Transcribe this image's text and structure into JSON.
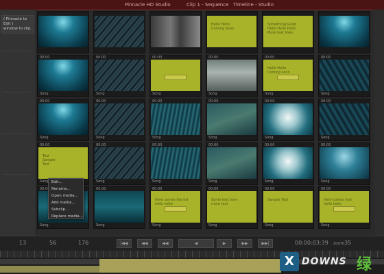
{
  "window": {
    "title_left": "Pinnacle HD Studio",
    "title_center": "Clip 1 - Sequence",
    "title_right": "Timeline - Studio"
  },
  "sidebar": {
    "note": "( Pinnacle to Edit )\nwindow to clip"
  },
  "tiles": [
    {
      "kind": "deep-sea",
      "tc": "",
      "label": ""
    },
    {
      "kind": "fish-school",
      "tc": "",
      "label": ""
    },
    {
      "kind": "branch",
      "tc": "",
      "label": ""
    },
    {
      "kind": "yellow",
      "tc": "",
      "label": "",
      "text": "Hello Hello\nComing Soon"
    },
    {
      "kind": "yellow",
      "tc": "",
      "label": "",
      "text": "Something Good\nHello Hello Hello\nMore text lines"
    },
    {
      "kind": "deep-sea",
      "tc": "",
      "label": ""
    },
    {
      "kind": "deep-sea",
      "tc": "00:00",
      "label": "Song"
    },
    {
      "kind": "fish-school",
      "tc": "00:00",
      "label": "Song"
    },
    {
      "kind": "yellow-btn",
      "tc": "00:00",
      "label": "Song"
    },
    {
      "kind": "rocks",
      "tc": "00:00",
      "label": "Song"
    },
    {
      "kind": "yellow-btn",
      "tc": "00:00",
      "label": "Song",
      "text": "Hello Hello\nComing soon"
    },
    {
      "kind": "fish-dark",
      "tc": "00:00",
      "label": "Song"
    },
    {
      "kind": "deep-sea",
      "tc": "00:00",
      "label": "Song"
    },
    {
      "kind": "fish-school",
      "tc": "00:00",
      "label": "Song"
    },
    {
      "kind": "kelp",
      "tc": "00:00",
      "label": "Song"
    },
    {
      "kind": "fish-teal",
      "tc": "00:00",
      "label": "Song"
    },
    {
      "kind": "cloud",
      "tc": "00:00",
      "label": "Song"
    },
    {
      "kind": "fish-dark",
      "tc": "00:00",
      "label": "Song"
    },
    {
      "kind": "yellow",
      "tc": "00:00",
      "label": "Song",
      "text": "Text\nSample\nText"
    },
    {
      "kind": "fish-school",
      "tc": "00:00",
      "label": "Song"
    },
    {
      "kind": "kelp",
      "tc": "00:00",
      "label": "Song"
    },
    {
      "kind": "fish-teal",
      "tc": "00:00",
      "label": "Song"
    },
    {
      "kind": "cloud",
      "tc": "00:00",
      "label": "Song"
    },
    {
      "kind": "fish-blue",
      "tc": "00:00",
      "label": "Song"
    },
    {
      "kind": "teal-dark",
      "tc": "00:00",
      "label": "Song"
    },
    {
      "kind": "teal-dark",
      "tc": "00:00",
      "label": "Song"
    },
    {
      "kind": "yellow-btn",
      "tc": "00:00",
      "label": "Song",
      "text": "Here comes the list\nhello hello"
    },
    {
      "kind": "yellow",
      "tc": "00:00",
      "label": "Song",
      "text": "Some text here\nmore text"
    },
    {
      "kind": "yellow",
      "tc": "00:00",
      "label": "Song",
      "text": "Sample Text"
    },
    {
      "kind": "yellow-btn",
      "tc": "00:00",
      "label": "Song",
      "text": "Here comes text\nhello hello"
    }
  ],
  "context_menu": [
    "Edit...",
    "Rename...",
    "Open media...",
    "Add media...",
    "Subclip...",
    "Replace media..."
  ],
  "transport": {
    "left_num_a": "13",
    "left_num_b": "56",
    "left_num_c": "176",
    "timecode": "00:00:03:39",
    "zoom_label": "zoom",
    "zoom_value": "35",
    "buttons": [
      "|◀◀",
      "◀◀",
      "◀◀",
      "◀",
      "▶",
      "▶▶",
      "▶▶|",
      "▶▶▶"
    ]
  },
  "watermark": {
    "letter": "X",
    "word": "DOWNS",
    "cn": "绿"
  },
  "colors": {
    "yellow_tile": "#a8b32a",
    "deep_sea": "#0d4f63",
    "accent": "#c8c84a"
  }
}
